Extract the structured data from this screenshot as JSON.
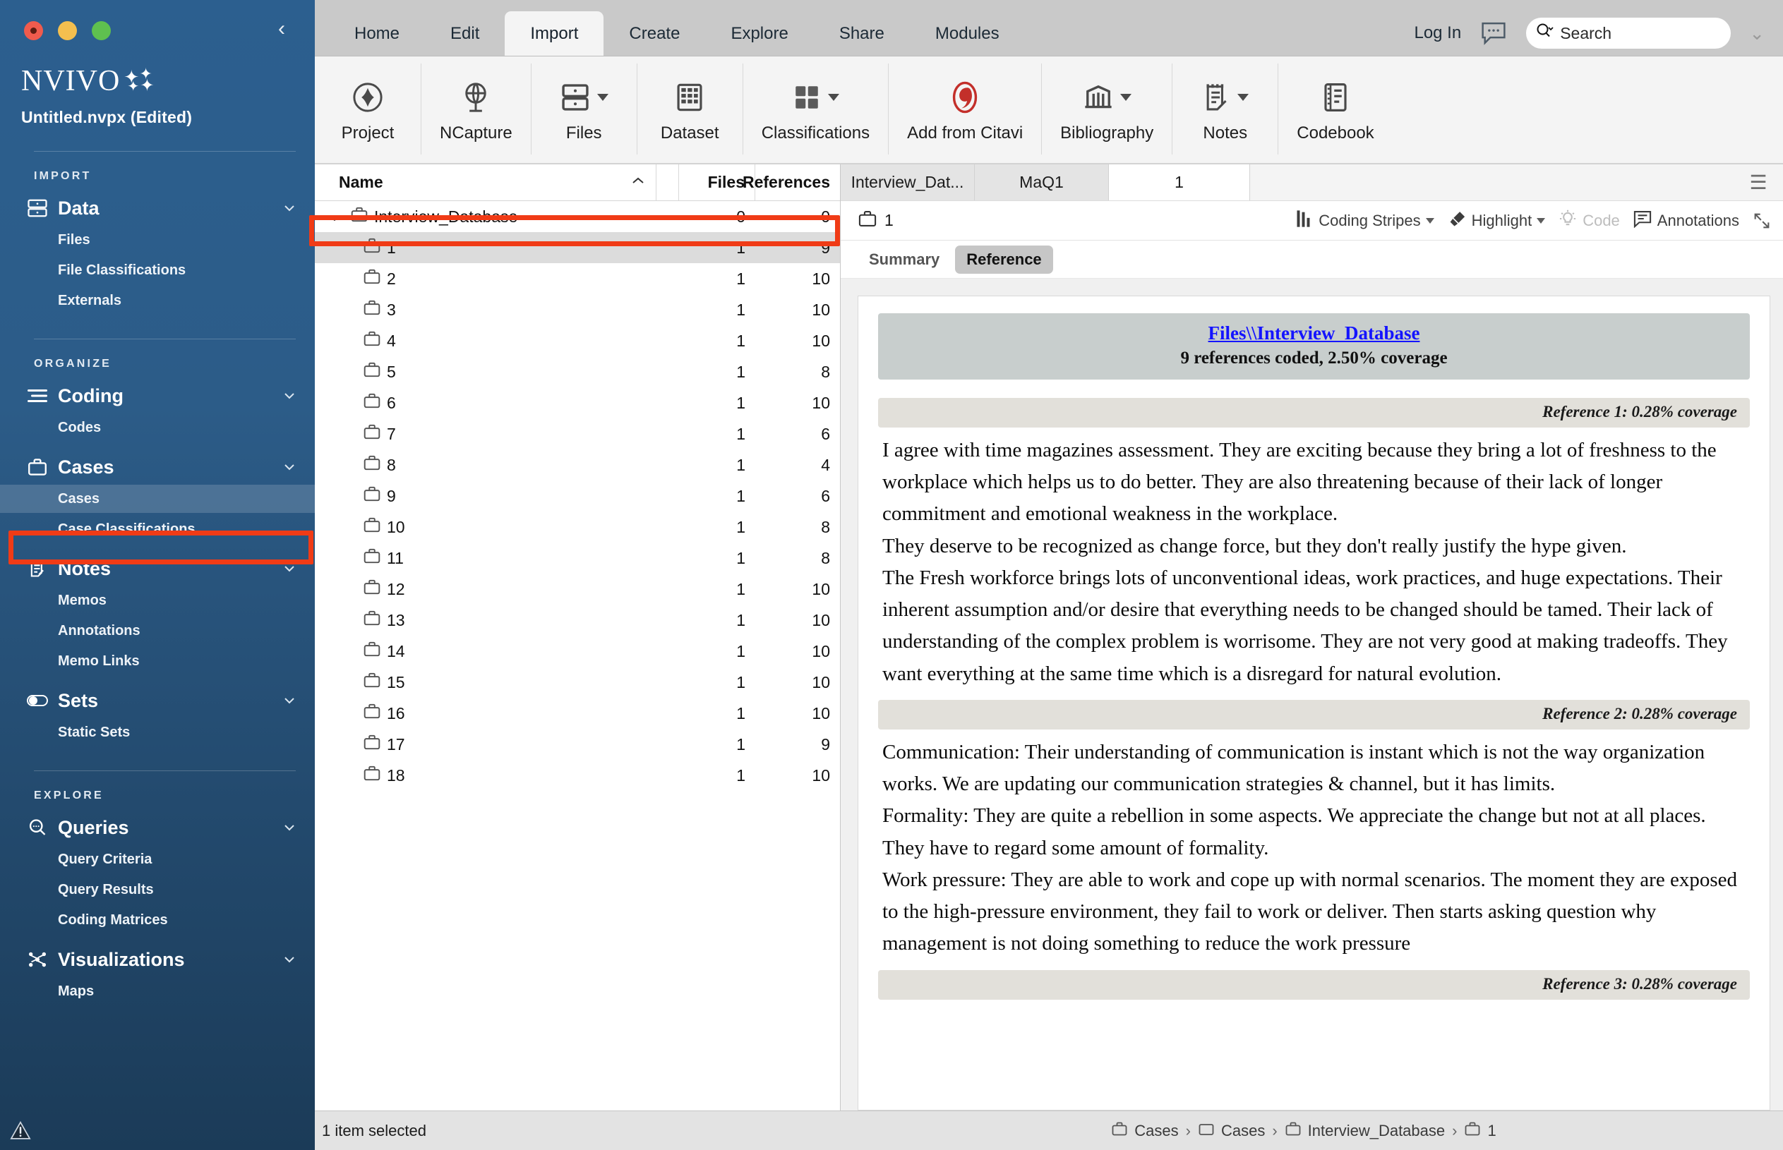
{
  "window": {
    "title": "Untitled.nvpx (Edited)",
    "brand": "NVIVO",
    "collapse_icon": "chevron-left-icon"
  },
  "sidebar": {
    "sections": [
      {
        "label": "IMPORT",
        "groups": [
          {
            "icon": "database-icon",
            "label": "Data",
            "chevron": "chevron-down-icon",
            "items": [
              {
                "label": "Files",
                "active": false
              },
              {
                "label": "File Classifications",
                "active": false
              },
              {
                "label": "Externals",
                "active": false
              }
            ]
          }
        ]
      },
      {
        "label": "ORGANIZE",
        "groups": [
          {
            "icon": "coding-lines-icon",
            "label": "Coding",
            "chevron": "chevron-down-icon",
            "items": [
              {
                "label": "Codes",
                "active": false
              }
            ]
          },
          {
            "icon": "briefcase-icon",
            "label": "Cases",
            "chevron": "chevron-down-icon",
            "items": [
              {
                "label": "Cases",
                "active": true
              },
              {
                "label": "Case Classifications",
                "active": false
              }
            ]
          },
          {
            "icon": "note-pencil-icon",
            "label": "Notes",
            "chevron": "chevron-down-icon",
            "items": [
              {
                "label": "Memos",
                "active": false
              },
              {
                "label": "Annotations",
                "active": false
              },
              {
                "label": "Memo Links",
                "active": false
              }
            ]
          },
          {
            "icon": "toggle-icon",
            "label": "Sets",
            "chevron": "chevron-down-icon",
            "items": [
              {
                "label": "Static Sets",
                "active": false
              }
            ]
          }
        ]
      },
      {
        "label": "EXPLORE",
        "groups": [
          {
            "icon": "search-dots-icon",
            "label": "Queries",
            "chevron": "chevron-down-icon",
            "items": [
              {
                "label": "Query Criteria",
                "active": false
              },
              {
                "label": "Query Results",
                "active": false
              },
              {
                "label": "Coding Matrices",
                "active": false
              }
            ]
          },
          {
            "icon": "network-nodes-icon",
            "label": "Visualizations",
            "chevron": "chevron-down-icon",
            "items": [
              {
                "label": "Maps",
                "active": false
              }
            ]
          }
        ]
      }
    ]
  },
  "ribbon": {
    "tabs": [
      {
        "label": "Home",
        "active": false
      },
      {
        "label": "Edit",
        "active": false
      },
      {
        "label": "Import",
        "active": true
      },
      {
        "label": "Create",
        "active": false
      },
      {
        "label": "Explore",
        "active": false
      },
      {
        "label": "Share",
        "active": false
      },
      {
        "label": "Modules",
        "active": false
      }
    ],
    "login_label": "Log In",
    "chat_icon": "chat-bubble-icon",
    "search_placeholder": "Search",
    "search_icon": "search-icon",
    "window_chevron": "chevron-down-icon",
    "commands": [
      {
        "label": "Project",
        "icon": "project-diamond-icon",
        "dropdown": false
      },
      {
        "label": "NCapture",
        "icon": "globe-pin-icon",
        "dropdown": false
      },
      {
        "label": "Files",
        "icon": "files-drawer-icon",
        "dropdown": true
      },
      {
        "label": "Dataset",
        "icon": "dataset-grid-icon",
        "dropdown": false
      },
      {
        "label": "Classifications",
        "icon": "classifications-squares-icon",
        "dropdown": true
      },
      {
        "label": "Add from Citavi",
        "icon": "citavi-icon",
        "dropdown": false
      },
      {
        "label": "Bibliography",
        "icon": "bibliography-icon",
        "dropdown": true
      },
      {
        "label": "Notes",
        "icon": "notes-pencil-icon",
        "dropdown": true
      },
      {
        "label": "Codebook",
        "icon": "codebook-icon",
        "dropdown": false
      }
    ]
  },
  "list_panel": {
    "columns": {
      "name": "Name",
      "files": "Files",
      "references": "References"
    },
    "sort_icon": "chevron-up-icon",
    "rows": [
      {
        "name": "Interview_Database",
        "files": "0",
        "references": "0",
        "level": 0,
        "expanded": true,
        "selected": false
      },
      {
        "name": "1",
        "files": "1",
        "references": "9",
        "level": 1,
        "selected": true
      },
      {
        "name": "2",
        "files": "1",
        "references": "10",
        "level": 1,
        "selected": false
      },
      {
        "name": "3",
        "files": "1",
        "references": "10",
        "level": 1,
        "selected": false
      },
      {
        "name": "4",
        "files": "1",
        "references": "10",
        "level": 1,
        "selected": false
      },
      {
        "name": "5",
        "files": "1",
        "references": "8",
        "level": 1,
        "selected": false
      },
      {
        "name": "6",
        "files": "1",
        "references": "10",
        "level": 1,
        "selected": false
      },
      {
        "name": "7",
        "files": "1",
        "references": "6",
        "level": 1,
        "selected": false
      },
      {
        "name": "8",
        "files": "1",
        "references": "4",
        "level": 1,
        "selected": false
      },
      {
        "name": "9",
        "files": "1",
        "references": "6",
        "level": 1,
        "selected": false
      },
      {
        "name": "10",
        "files": "1",
        "references": "8",
        "level": 1,
        "selected": false
      },
      {
        "name": "11",
        "files": "1",
        "references": "8",
        "level": 1,
        "selected": false
      },
      {
        "name": "12",
        "files": "1",
        "references": "10",
        "level": 1,
        "selected": false
      },
      {
        "name": "13",
        "files": "1",
        "references": "10",
        "level": 1,
        "selected": false
      },
      {
        "name": "14",
        "files": "1",
        "references": "10",
        "level": 1,
        "selected": false
      },
      {
        "name": "15",
        "files": "1",
        "references": "10",
        "level": 1,
        "selected": false
      },
      {
        "name": "16",
        "files": "1",
        "references": "10",
        "level": 1,
        "selected": false
      },
      {
        "name": "17",
        "files": "1",
        "references": "9",
        "level": 1,
        "selected": false
      },
      {
        "name": "18",
        "files": "1",
        "references": "10",
        "level": 1,
        "selected": false
      }
    ]
  },
  "detail_panel": {
    "doc_tabs": [
      {
        "label": "Interview_Dat...",
        "active": false
      },
      {
        "label": "MaQ1",
        "active": false
      },
      {
        "label": "1",
        "active": true
      }
    ],
    "burger_icon": "hamburger-menu-icon",
    "open_item": "1",
    "open_item_icon": "briefcase-icon",
    "toolbar": [
      {
        "label": "Coding Stripes",
        "icon": "coding-stripes-icon",
        "dropdown": true,
        "disabled": false
      },
      {
        "label": "Highlight",
        "icon": "highlighter-icon",
        "dropdown": true,
        "disabled": false
      },
      {
        "label": "Code",
        "icon": "lightbulb-icon",
        "dropdown": false,
        "disabled": true
      },
      {
        "label": "Annotations",
        "icon": "annotation-icon",
        "dropdown": false,
        "disabled": false
      }
    ],
    "expand_icon": "expand-diagonal-icon",
    "subtabs": [
      {
        "label": "Summary",
        "active": false
      },
      {
        "label": "Reference",
        "active": true
      }
    ],
    "document": {
      "source_link": "Files\\\\Interview_Database",
      "coverage_summary": "9 references coded, 2.50% coverage",
      "references": [
        {
          "header": "Reference 1: 0.28% coverage",
          "paragraphs": [
            "I agree with time magazines assessment.  They are exciting because they bring a lot of freshness to the workplace which helps us to do better. They are also threatening because of their lack of longer commitment and emotional weakness in the workplace.",
            "They deserve to be recognized as change force, but they don't really justify the hype given.",
            "The Fresh workforce brings lots of unconventional ideas, work practices, and huge expectations. Their inherent assumption and/or desire that everything needs to be changed should be tamed. Their lack of understanding of the complex problem is worrisome. They are not very good at making tradeoffs. They want everything at the same time which is a disregard for natural evolution."
          ]
        },
        {
          "header": "Reference 2: 0.28% coverage",
          "paragraphs": [
            "Communication: Their understanding of communication is instant which is not the way organization works. We are updating our communication strategies & channel, but it has limits.",
            "Formality: They are quite a rebellion in some aspects. We appreciate the change but not at all places. They have to regard some amount of formality.",
            " Work pressure: They are able to work and cope up with normal scenarios. The moment they are exposed to the high-pressure environment, they fail to work or deliver. Then starts asking question why management is not doing something to reduce the work pressure"
          ]
        },
        {
          "header": "Reference 3: 0.28% coverage",
          "paragraphs": []
        }
      ]
    }
  },
  "status_bar": {
    "selection_text": "1 item selected",
    "breadcrumb": [
      {
        "icon": "briefcase-icon",
        "label": "Cases"
      },
      {
        "icon": "folder-icon",
        "label": "Cases"
      },
      {
        "icon": "briefcase-icon",
        "label": "Interview_Database"
      },
      {
        "icon": "briefcase-icon",
        "label": "1"
      }
    ],
    "separator": "›"
  },
  "annotations": {
    "accent_color": "#f03b16",
    "boxes": [
      {
        "name": "sidebar-cases-highlight"
      },
      {
        "name": "list-row-1-highlight"
      }
    ]
  }
}
